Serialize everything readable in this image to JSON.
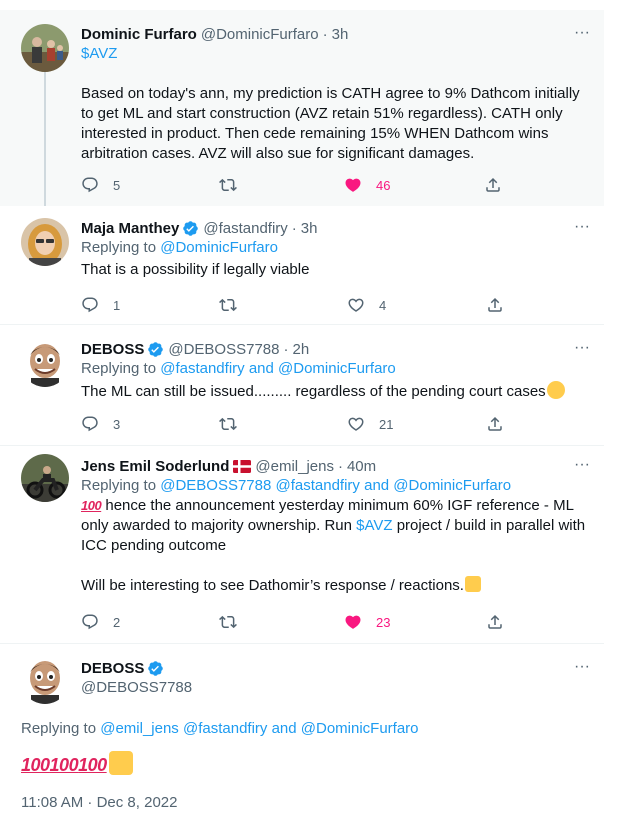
{
  "tweets": [
    {
      "name": "Dominic Furfaro",
      "handle": "@DominicFurfaro",
      "time": "3h",
      "cashtag": "$AVZ",
      "text": "Based on today's ann, my prediction is CATH agree to 9% Dathcom initially to get ML and start construction (AVZ retain 51% regardless). CATH only interested in product. Then cede remaining 15% WHEN Dathcom wins arbitration cases. AVZ will also sue for significant damages.",
      "replies": "5",
      "retweets": "",
      "likes": "46"
    },
    {
      "name": "Maja Manthey",
      "handle": "@fastandfiry",
      "time": "3h",
      "replying_prefix": "Replying to ",
      "replying_to": "@DominicFurfaro",
      "text": "That is a possibility if legally viable",
      "replies": "1",
      "retweets": "",
      "likes": "4"
    },
    {
      "name": "DEBOSS",
      "handle": "@DEBOSS7788",
      "time": "2h",
      "replying_prefix": "Replying to ",
      "replying_to": "@fastandfiry and @DominicFurfaro",
      "text": "The ML can still be issued......... regardless of the pending court cases",
      "replies": "3",
      "retweets": "",
      "likes": "21"
    },
    {
      "name": "Jens Emil Soderlund",
      "handle": "@emil_jens",
      "time": "40m",
      "replying_prefix": "Replying to ",
      "replying_to": "@DEBOSS7788 @fastandfiry and @DominicFurfaro",
      "text_a": " hence the announcement yesterday minimum 60% IGF reference - ML only awarded to majority ownership. Run ",
      "cashtag": "$AVZ",
      "text_b": " project / build in parallel with ICC pending outcome",
      "text_c": "Will be interesting to see Dathomir’s response / reactions.",
      "replies": "2",
      "retweets": "",
      "likes": "23"
    }
  ],
  "main": {
    "name": "DEBOSS",
    "handle": "@DEBOSS7788",
    "replying_prefix": "Replying to ",
    "replying_to": "@emil_jens @fastandfiry and @DominicFurfaro",
    "emoji_hundred": "100",
    "timestamp": "11:08 AM · Dec 8, 2022"
  },
  "common": {
    "more": "···",
    "dot": "·"
  },
  "colors": {
    "accent": "#1d9bf0",
    "like": "#f91880",
    "muted": "#536471"
  },
  "icons": {
    "reply": "reply-icon",
    "retweet": "retweet-icon",
    "like": "like-icon",
    "share": "share-icon"
  }
}
